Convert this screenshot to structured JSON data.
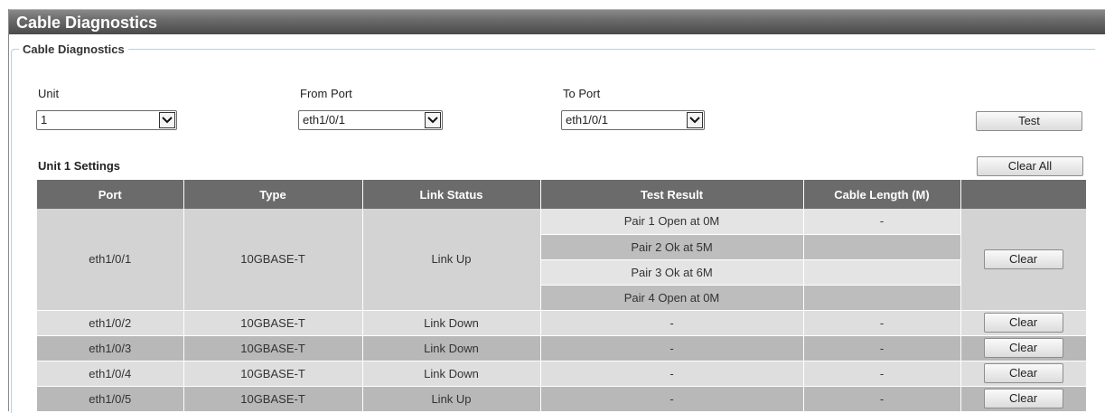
{
  "page": {
    "title": "Cable Diagnostics"
  },
  "group": {
    "legend": "Cable Diagnostics"
  },
  "controls": {
    "unit_label": "Unit",
    "unit_value": "1",
    "from_port_label": "From Port",
    "from_port_value": "eth1/0/1",
    "to_port_label": "To Port",
    "to_port_value": "eth1/0/1",
    "test_button": "Test"
  },
  "results": {
    "section_title": "Unit 1 Settings",
    "clear_all_button": "Clear All",
    "columns": [
      "Port",
      "Type",
      "Link Status",
      "Test Result",
      "Cable Length (M)",
      ""
    ],
    "expanded_row": {
      "port": "eth1/0/1",
      "type": "10GBASE-T",
      "link_status": "Link Up",
      "pairs": [
        {
          "result": "Pair 1 Open at 0M",
          "length": "-"
        },
        {
          "result": "Pair 2 Ok at 5M",
          "length": ""
        },
        {
          "result": "Pair 3 Ok at 6M",
          "length": ""
        },
        {
          "result": "Pair 4 Open at 0M",
          "length": ""
        }
      ],
      "action": "Clear"
    },
    "rows": [
      {
        "port": "eth1/0/2",
        "type": "10GBASE-T",
        "link_status": "Link Down",
        "result": "-",
        "length": "-",
        "action": "Clear"
      },
      {
        "port": "eth1/0/3",
        "type": "10GBASE-T",
        "link_status": "Link Down",
        "result": "-",
        "length": "-",
        "action": "Clear"
      },
      {
        "port": "eth1/0/4",
        "type": "10GBASE-T",
        "link_status": "Link Down",
        "result": "-",
        "length": "-",
        "action": "Clear"
      },
      {
        "port": "eth1/0/5",
        "type": "10GBASE-T",
        "link_status": "Link Up",
        "result": "-",
        "length": "-",
        "action": "Clear"
      }
    ]
  },
  "icons": {
    "dropdown": "chevron-down-icon"
  },
  "colors": {
    "header_bg": "#6b6b6b",
    "title_bar": "#5a5a5a",
    "row_light": "#dedede",
    "row_dark": "#b8b8b8"
  }
}
